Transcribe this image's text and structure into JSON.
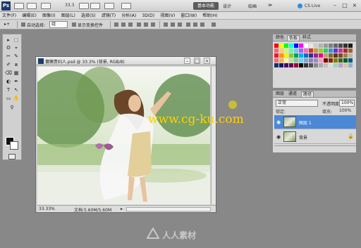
{
  "appbar": {
    "logo": "Ps",
    "zoom": "33.3",
    "workspace_button": "基本功能",
    "links": [
      "设计",
      "绘画",
      "≫"
    ],
    "cs_live": "CS Live",
    "win_min": "–",
    "win_max": "□",
    "win_close": "×"
  },
  "menubar": {
    "items": [
      "文件(F)",
      "编辑(E)",
      "图像(I)",
      "图层(L)",
      "选择(S)",
      "滤镜(T)",
      "分析(A)",
      "3D(D)",
      "视图(V)",
      "窗口(W)",
      "帮助(H)"
    ]
  },
  "options": {
    "auto_select_label": "自动选择:",
    "auto_select_value": "组",
    "show_transform_label": "显示变换控件"
  },
  "tools": [
    "▸",
    "⬚",
    "ʘ",
    "⌖",
    "✂",
    "✎",
    "✐",
    "⧈",
    "⌫",
    "▦",
    "◐",
    "✒",
    "T",
    "↖",
    "▭",
    "✋",
    "⚲"
  ],
  "document": {
    "title": "慵懒贵妇人.psd @ 33.3% (背景, RGB/8)",
    "zoom": "33.33%",
    "doc_size": "文档:5.60M/5.60M",
    "min": "–",
    "max": "□",
    "close": "×"
  },
  "swatches_panel": {
    "tabs": [
      "颜色",
      "色板",
      "样式"
    ],
    "active_tab": "色板",
    "colors": [
      "#ff0000",
      "#ffff00",
      "#00ff00",
      "#00ffff",
      "#0000ff",
      "#ff00ff",
      "#ffffff",
      "#e6e6e6",
      "#cccccc",
      "#b3b3b3",
      "#999999",
      "#808080",
      "#666666",
      "#4d4d4d",
      "#333333",
      "#1a1a1a",
      "#ff6666",
      "#ffcc66",
      "#ccff66",
      "#66ff99",
      "#66ccff",
      "#9966ff",
      "#ff66cc",
      "#cc3333",
      "#cc9933",
      "#99cc33",
      "#33cc66",
      "#3399cc",
      "#6633cc",
      "#cc3399",
      "#993333",
      "#996633",
      "#ed1c24",
      "#f7941d",
      "#fff200",
      "#8dc63f",
      "#00a651",
      "#00aeef",
      "#0072bc",
      "#2e3192",
      "#92278f",
      "#ec008c",
      "#c69c6d",
      "#8c6239",
      "#603913",
      "#754c24",
      "#a67c52",
      "#c7b299",
      "#f26d7d",
      "#fbaf5d",
      "#fff799",
      "#c4df9b",
      "#82ca9c",
      "#6dcff6",
      "#7da7d9",
      "#8781bd",
      "#a187be",
      "#f49ac1",
      "#790000",
      "#7b2e00",
      "#827b00",
      "#406618",
      "#005e20",
      "#005b7f",
      "#003471",
      "#1b1464",
      "#440e62",
      "#630460",
      "#9e0039",
      "#000000",
      "#363636",
      "#535353",
      "#898989",
      "#aaaaaa",
      "#c0c0c0",
      "#dcdcdc",
      "#a3d4b8",
      "#b3a7d3",
      "#e0c0a0",
      "#8fb0d0"
    ]
  },
  "layers_panel": {
    "tabs": [
      "图层",
      "通道",
      "路径"
    ],
    "active_tab": "路径",
    "blend_mode": "正常",
    "opacity_label": "不透明度:",
    "opacity_value": "100%",
    "lock_label": "锁定:",
    "fill_label": "填充:",
    "fill_value": "100%",
    "layers": [
      {
        "name": "图层 1",
        "selected": true
      },
      {
        "name": "背景",
        "selected": false
      }
    ]
  },
  "watermarks": {
    "cg": "www.cg-ku.com",
    "cn": "人人素材"
  }
}
